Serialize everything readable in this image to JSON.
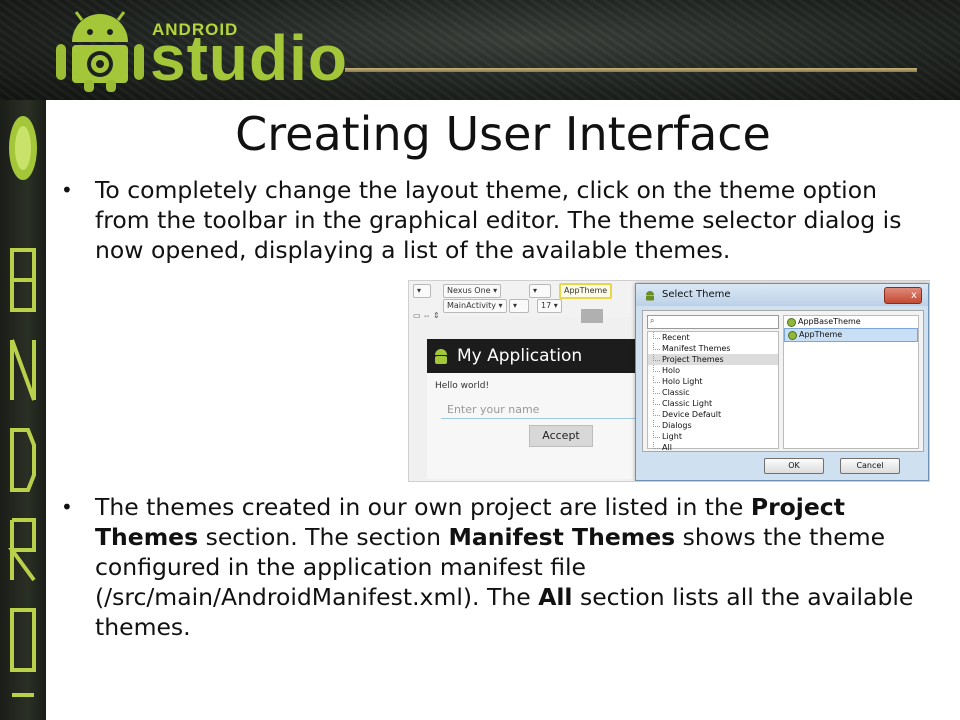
{
  "header": {
    "brand_small": "ANDROID",
    "brand_big": "studio",
    "colors": {
      "brand_green": "#a4c739",
      "banner_dark": "#1e221e"
    },
    "side_wordmark": "ANDROID"
  },
  "slide": {
    "title": "Creating User Interface",
    "bullet1": "To completely change the layout theme, click on the theme option from the toolbar in the graphical editor. The theme selector dialog is now opened, displaying a list of the available themes.",
    "bullet2": {
      "t1": "The themes created in our own project are listed in the ",
      "b1": "Project Themes",
      "t2": " section. The section ",
      "b2": "Manifest Themes",
      "t3": " shows the theme configured in the application manifest file (/src/main/AndroidManifest.xml). The ",
      "b3": "All",
      "t4": " section lists all the available themes."
    }
  },
  "screenshot": {
    "toolbar": {
      "device": "Nexus One",
      "theme": "AppTheme",
      "activity": "MainActivity",
      "api": "17"
    },
    "phone": {
      "app_title": "My Application",
      "hello_text": "Hello world!",
      "input_placeholder": "Enter your name",
      "button_label": "Accept"
    },
    "dialog": {
      "title": "Select Theme",
      "close_label": "x",
      "categories": [
        "Recent",
        "Manifest Themes",
        "Project Themes",
        "Holo",
        "Holo Light",
        "Classic",
        "Classic Light",
        "Device Default",
        "Dialogs",
        "Light",
        "All"
      ],
      "selected_category": "Project Themes",
      "themes": [
        "AppBaseTheme",
        "AppTheme"
      ],
      "selected_theme": "AppTheme",
      "ok_label": "OK",
      "cancel_label": "Cancel"
    }
  }
}
